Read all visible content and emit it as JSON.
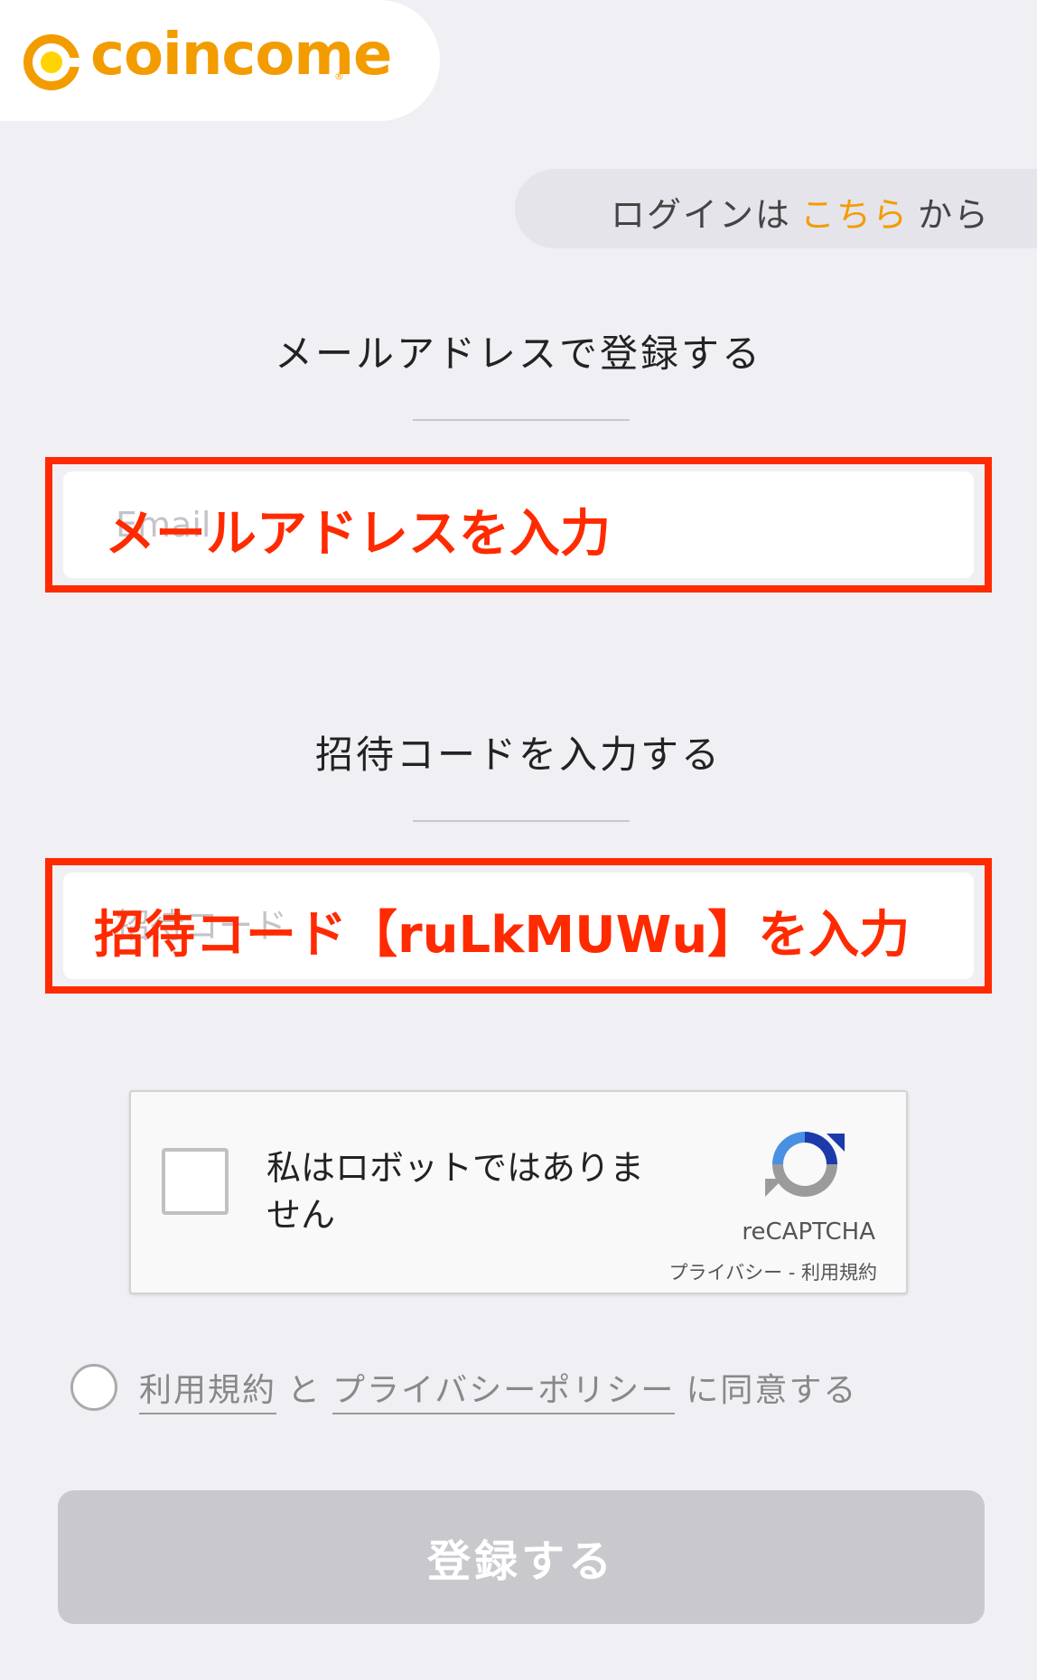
{
  "brand": {
    "name": "coincome",
    "registered_mark": "®",
    "color": "#f39c00"
  },
  "login_prompt": {
    "prefix": "ログインは",
    "link": "こちら",
    "suffix": "から"
  },
  "email_section": {
    "title": "メールアドレスで登録する",
    "placeholder": "Email",
    "overlay_label": "メールアドレスを入力"
  },
  "invite_section": {
    "title": "招待コードを入力する",
    "placeholder": "招待コード",
    "overlay_label": "招待コード【ruLkMUWu】を入力"
  },
  "recaptcha": {
    "label": "私はロボットではありません",
    "brand": "reCAPTCHA",
    "links": "プライバシー - 利用規約"
  },
  "agreement": {
    "terms": "利用規約",
    "conjunction": "と",
    "privacy": "プライバシーポリシー",
    "suffix": "に同意する"
  },
  "submit": {
    "label": "登録する"
  },
  "colors": {
    "background": "#efeff4",
    "annotation": "#ff2a00",
    "disabled_button": "#c8c8cd"
  }
}
